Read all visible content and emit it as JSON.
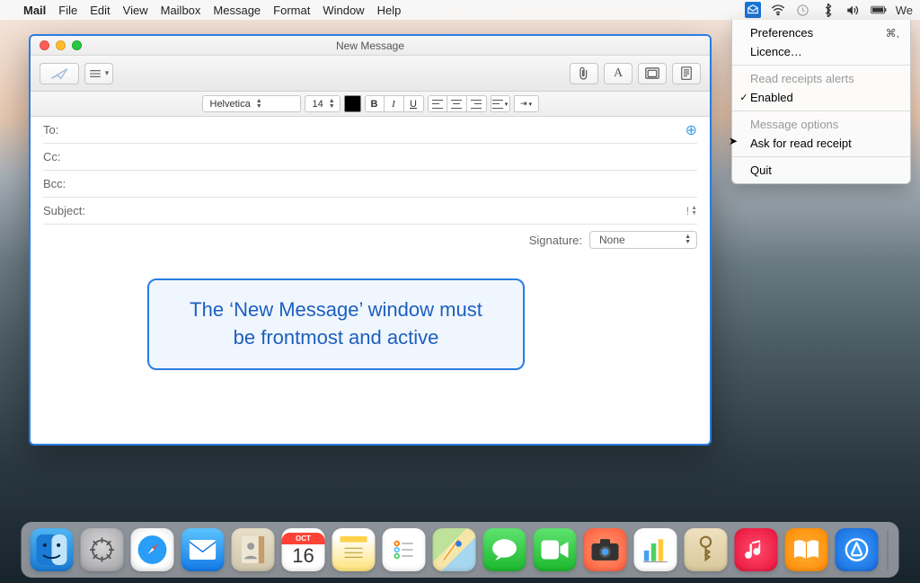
{
  "menubar": {
    "app_name": "Mail",
    "items": [
      "File",
      "Edit",
      "View",
      "Mailbox",
      "Message",
      "Format",
      "Window",
      "Help"
    ],
    "status_right_text": "We"
  },
  "status_menu": {
    "preferences": "Preferences",
    "preferences_shortcut": "⌘,",
    "licence": "Licence…",
    "header_receipts": "Read receipts alerts",
    "enabled": "Enabled",
    "header_message": "Message options",
    "ask_receipt": "Ask for read receipt",
    "quit": "Quit"
  },
  "compose": {
    "title": "New Message",
    "format": {
      "font": "Helvetica",
      "size": "14"
    },
    "fields": {
      "to": "To:",
      "cc": "Cc:",
      "bcc": "Bcc:",
      "subject": "Subject:"
    },
    "signature_label": "Signature:",
    "signature_value": "None"
  },
  "callout": {
    "line1": "The ‘New Message’ window must",
    "line2": "be frontmost and active"
  },
  "dock": {
    "calendar_day": "16",
    "calendar_month": "OCT"
  }
}
